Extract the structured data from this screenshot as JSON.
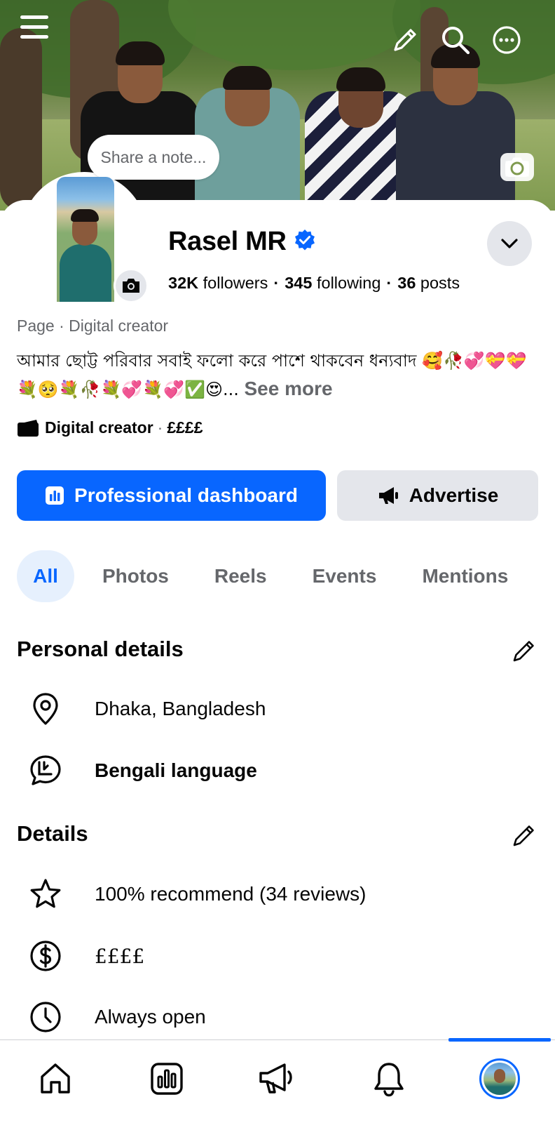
{
  "header": {
    "note_placeholder": "Share a note..."
  },
  "profile": {
    "name": "Rasel MR",
    "verified": true,
    "followers_count": "32K",
    "followers_label": "followers",
    "following_count": "345",
    "following_label": "following",
    "posts_count": "36",
    "posts_label": "posts",
    "separator": "·",
    "category": "Page · Digital creator",
    "bio": "আমার ছোট্ট পরিবার সবাই ফলো করে পাশে থাকবেন ধন্যবাদ 🥰🥀💞💝💝💐🥺💐🥀💐💞💐💞✅😍...",
    "see_more": "See more",
    "creator_label": "Digital creator",
    "creator_sep": "·",
    "price_range": "££££"
  },
  "actions": {
    "dashboard_label": "Professional dashboard",
    "advertise_label": "Advertise"
  },
  "tabs": [
    {
      "label": "All",
      "active": true
    },
    {
      "label": "Photos",
      "active": false
    },
    {
      "label": "Reels",
      "active": false
    },
    {
      "label": "Events",
      "active": false
    },
    {
      "label": "Mentions",
      "active": false
    }
  ],
  "personal_details": {
    "title": "Personal details",
    "items": [
      {
        "icon": "location-pin-icon",
        "text": "Dhaka, Bangladesh"
      },
      {
        "icon": "speech-bubble-icon",
        "text": "Bengali language"
      }
    ]
  },
  "details": {
    "title": "Details",
    "items": [
      {
        "icon": "star-icon",
        "text": "100% recommend (34 reviews)"
      },
      {
        "icon": "dollar-icon",
        "text": "££££"
      },
      {
        "icon": "clock-icon",
        "text": "Always open"
      }
    ]
  },
  "bottom_nav": [
    {
      "icon": "home-icon"
    },
    {
      "icon": "dashboard-icon"
    },
    {
      "icon": "megaphone-icon"
    },
    {
      "icon": "bell-icon"
    },
    {
      "icon": "profile-avatar",
      "active": true
    }
  ],
  "colors": {
    "accent": "#0866ff",
    "secondary_bg": "#e4e6eb",
    "muted_text": "#65676b",
    "verified": "#0866ff"
  }
}
